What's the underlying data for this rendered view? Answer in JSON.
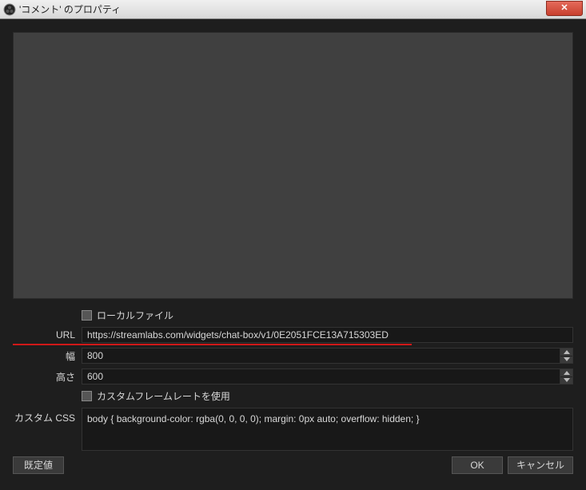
{
  "window": {
    "title": "'コメント' のプロパティ"
  },
  "form": {
    "local_file_label": "ローカルファイル",
    "url_label": "URL",
    "url_value": "https://streamlabs.com/widgets/chat-box/v1/0E2051FCE13A715303ED",
    "width_label": "幅",
    "width_value": "800",
    "height_label": "高さ",
    "height_value": "600",
    "custom_framerate_label": "カスタムフレームレートを使用",
    "custom_css_label": "カスタム CSS",
    "custom_css_value": "body { background-color: rgba(0, 0, 0, 0); margin: 0px auto; overflow: hidden; }"
  },
  "buttons": {
    "defaults": "既定値",
    "ok": "OK",
    "cancel": "キャンセル"
  }
}
